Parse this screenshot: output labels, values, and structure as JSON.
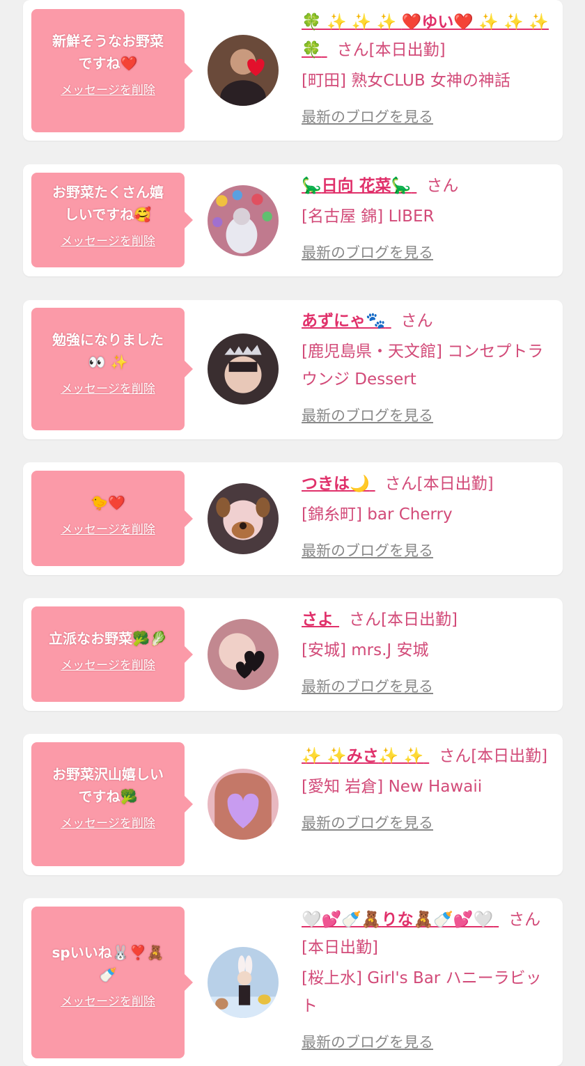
{
  "items": [
    {
      "message": "新鮮そうなお野菜\nですね❤️",
      "delete_label": "メッセージを削除",
      "name_prefix": "🍀 ✨ ✨ ✨ ",
      "name": "❤️ゆい❤️",
      "name_suffix": " ✨ ✨ ✨ 🍀",
      "san": "さん[本日出勤]",
      "shop": "[町田] 熟女CLUB 女神の神話",
      "blog": "最新のブログを見る",
      "avatar_icon": "avatar-icon",
      "avatar_color": "#6a4a3a"
    },
    {
      "message": "お野菜たくさん嬉\nしいですね🥰",
      "delete_label": "メッセージを削除",
      "name_prefix": "🦕",
      "name": "日向 花菜",
      "name_suffix": "🦕",
      "san": "さん",
      "shop": "[名古屋 錦] LIBER",
      "blog": "最新のブログを見る",
      "avatar_icon": "avatar-icon",
      "avatar_color": "#c07a8e"
    },
    {
      "message": "勉強になりました\n👀 ✨",
      "delete_label": "メッセージを削除",
      "name_prefix": "",
      "name": "あずにゃ",
      "name_suffix": "🐾",
      "san": "さん",
      "shop": "[鹿児島県・天文館] コンセプトラウンジ Dessert",
      "blog": "最新のブログを見る",
      "avatar_icon": "avatar-icon",
      "avatar_color": "#3a2e30"
    },
    {
      "message": "🐤❤️",
      "delete_label": "メッセージを削除",
      "name_prefix": "",
      "name": "つきは",
      "name_suffix": "🌙",
      "san": "さん[本日出勤]",
      "shop": "[錦糸町] bar Cherry",
      "blog": "最新のブログを見る",
      "avatar_icon": "avatar-icon",
      "avatar_color": "#4a3a3e"
    },
    {
      "message": "立派なお野菜🥦🥬",
      "delete_label": "メッセージを削除",
      "name_prefix": "",
      "name": "さよ",
      "name_suffix": "",
      "san": "さん[本日出勤]",
      "shop": "[安城] mrs.J 安城",
      "blog": "最新のブログを見る",
      "avatar_icon": "avatar-icon",
      "avatar_color": "#c28890"
    },
    {
      "message": "お野菜沢山嬉しい\nですね🥦",
      "delete_label": "メッセージを削除",
      "name_prefix": "✨ ✨",
      "name": "みさ",
      "name_suffix": "✨ ✨",
      "san": "さん[本日出勤]",
      "shop": "[愛知 岩倉] New Hawaii",
      "blog": "最新のブログを見る",
      "avatar_icon": "avatar-icon",
      "avatar_color": "#e8b8c0"
    },
    {
      "message": "spいいね🐰❣️🧸\n🍼",
      "delete_label": "メッセージを削除",
      "name_prefix": "🤍💕🍼🧸",
      "name": "りな",
      "name_suffix": "🧸🍼💕🤍",
      "san": "さん[本日出勤]",
      "shop": "[桜上水] Girl's Bar ハニーラビット",
      "blog": "最新のブログを見る",
      "avatar_icon": "avatar-icon",
      "avatar_color": "#b8d0e8"
    }
  ]
}
